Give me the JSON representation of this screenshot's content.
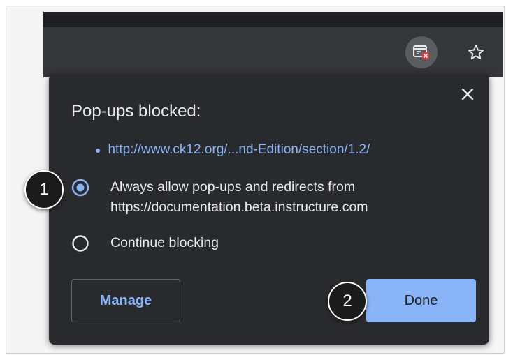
{
  "colors": {
    "dialog_bg": "#292a2d",
    "toolbar_bg": "#35363a",
    "link_blue": "#8ab4f8",
    "text": "#e8eaed",
    "done_bg": "#8ab4f8"
  },
  "toolbar": {
    "popup_icon": "popup-blocked-icon",
    "star_icon": "star-icon"
  },
  "dialog": {
    "title": "Pop-ups blocked:",
    "blocked_url": "http://www.ck12.org/...nd-Edition/section/1.2/",
    "options": [
      {
        "line1": "Always allow pop-ups and redirects from",
        "line2": "https://documentation.beta.instructure.com",
        "selected": true
      },
      {
        "line1": "Continue blocking",
        "selected": false
      }
    ],
    "manage_label": "Manage",
    "done_label": "Done",
    "close_icon": "close-icon"
  },
  "steps": {
    "step1": "1",
    "step2": "2"
  }
}
